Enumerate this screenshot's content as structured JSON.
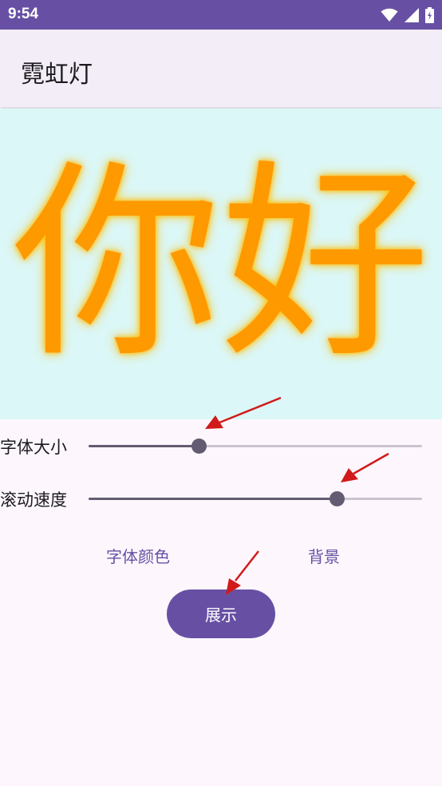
{
  "status_bar": {
    "time": "9:54",
    "icons": [
      "wifi-icon",
      "signal-icon",
      "battery-charging-icon"
    ]
  },
  "app_bar": {
    "title": "霓虹灯"
  },
  "preview": {
    "text": "你好",
    "text_color": "#ff9900",
    "glow_color": "#ffc400",
    "background_color": "#dbf7f7"
  },
  "controls": {
    "font_size": {
      "label": "字体大小",
      "value_fraction": 0.33
    },
    "scroll_speed": {
      "label": "滚动速度",
      "value_fraction": 0.745
    }
  },
  "buttons": {
    "font_color_label": "字体颜色",
    "background_label": "背景",
    "show_label": "展示"
  },
  "colors": {
    "primary": "#6750a4",
    "slider": "#625b71",
    "annotation_arrow": "#d11a1a"
  }
}
